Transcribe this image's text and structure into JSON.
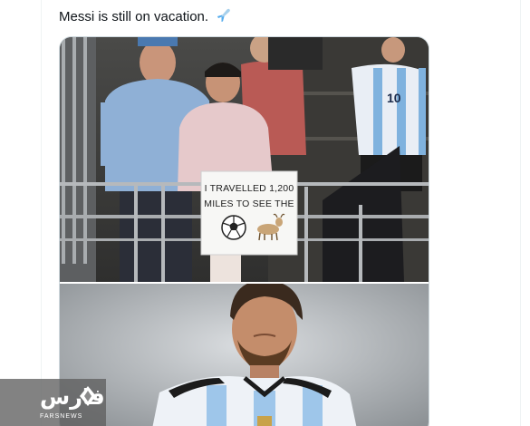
{
  "tweet": {
    "text": "Messi is still on vacation.",
    "emoji": "airplane-emoji"
  },
  "media": {
    "photo_1": {
      "sign_lines": [
        "I TRAVELLED 1,200",
        "MILES TO SEE THE"
      ],
      "jersey_number": "10"
    },
    "photo_2": {}
  },
  "watermark": {
    "logo": "فارس",
    "name": "FARSNEWS"
  }
}
